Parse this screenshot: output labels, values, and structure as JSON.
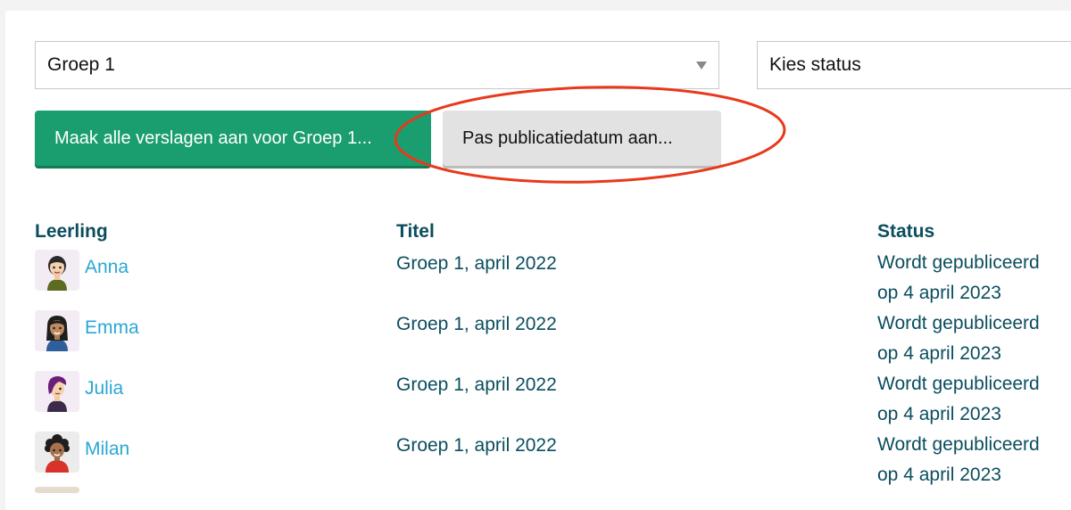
{
  "filters": {
    "group_select": "Groep 1",
    "status_select": "Kies status"
  },
  "buttons": {
    "create_reports": "Maak alle verslagen aan voor Groep 1...",
    "adjust_date": "Pas publicatiedatum aan..."
  },
  "table": {
    "headers": {
      "student": "Leerling",
      "title": "Titel",
      "status": "Status"
    },
    "rows": [
      {
        "name": "Anna",
        "title": "Groep 1, april 2022",
        "status_line1": "Wordt gepubliceerd",
        "status_line2": "op 4 april 2023"
      },
      {
        "name": "Emma",
        "title": "Groep 1, april 2022",
        "status_line1": "Wordt gepubliceerd",
        "status_line2": "op 4 april 2023"
      },
      {
        "name": "Julia",
        "title": "Groep 1, april 2022",
        "status_line1": "Wordt gepubliceerd",
        "status_line2": "op 4 april 2023"
      },
      {
        "name": "Milan",
        "title": "Groep 1, april 2022",
        "status_line1": "Wordt gepubliceerd",
        "status_line2": "op 4 april 2023"
      }
    ]
  },
  "colors": {
    "primary_button": "#1a9e6f",
    "link": "#2aa7d4",
    "heading": "#0b4d5e",
    "annotation": "#e8391c"
  }
}
